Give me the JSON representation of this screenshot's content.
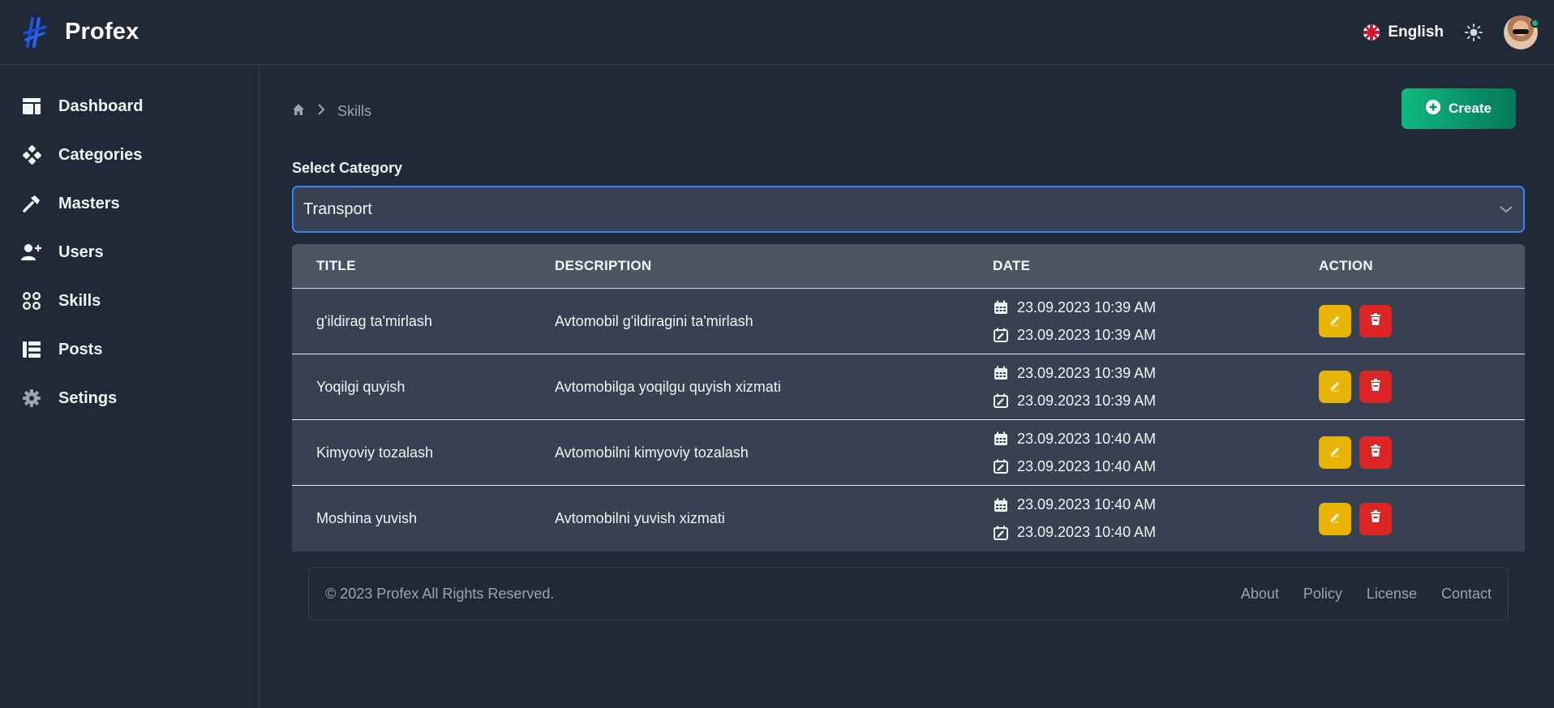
{
  "app": {
    "name": "Profex",
    "logo_icon": "profex-logo-icon"
  },
  "header": {
    "language_label": "English",
    "theme_icon": "sun-icon"
  },
  "sidebar": {
    "items": [
      {
        "label": "Dashboard",
        "icon": "dashboard-icon"
      },
      {
        "label": "Categories",
        "icon": "categories-icon"
      },
      {
        "label": "Masters",
        "icon": "hammer-icon"
      },
      {
        "label": "Users",
        "icon": "user-plus-icon"
      },
      {
        "label": "Skills",
        "icon": "skills-icon"
      },
      {
        "label": "Posts",
        "icon": "list-icon"
      },
      {
        "label": "Setings",
        "icon": "gear-icon"
      }
    ]
  },
  "breadcrumb": {
    "current": "Skills"
  },
  "actions": {
    "create_label": "Create"
  },
  "filter": {
    "label": "Select Category",
    "selected": "Transport"
  },
  "table": {
    "headers": [
      "TITLE",
      "DESCRIPTION",
      "DATE",
      "ACTION"
    ],
    "rows": [
      {
        "title": "g'ildirag ta'mirlash",
        "description": "Avtomobil g'ildiragini ta'mirlash",
        "created": "23.09.2023 10:39 AM",
        "updated": "23.09.2023 10:39 AM"
      },
      {
        "title": "Yoqilgi quyish",
        "description": "Avtomobilga yoqilgu quyish xizmati",
        "created": "23.09.2023 10:39 AM",
        "updated": "23.09.2023 10:39 AM"
      },
      {
        "title": "Kimyoviy tozalash",
        "description": "Avtomobilni kimyoviy tozalash",
        "created": "23.09.2023 10:40 AM",
        "updated": "23.09.2023 10:40 AM"
      },
      {
        "title": "Moshina yuvish",
        "description": "Avtomobilni yuvish xizmati",
        "created": "23.09.2023 10:40 AM",
        "updated": "23.09.2023 10:40 AM"
      }
    ]
  },
  "footer": {
    "copyright": "© 2023 Profex All Rights Reserved.",
    "links": [
      "About",
      "Policy",
      "License",
      "Contact"
    ]
  },
  "colors": {
    "accent": "#10b981",
    "edit": "#eab308",
    "delete": "#dc2626",
    "focus": "#3b82f6"
  }
}
